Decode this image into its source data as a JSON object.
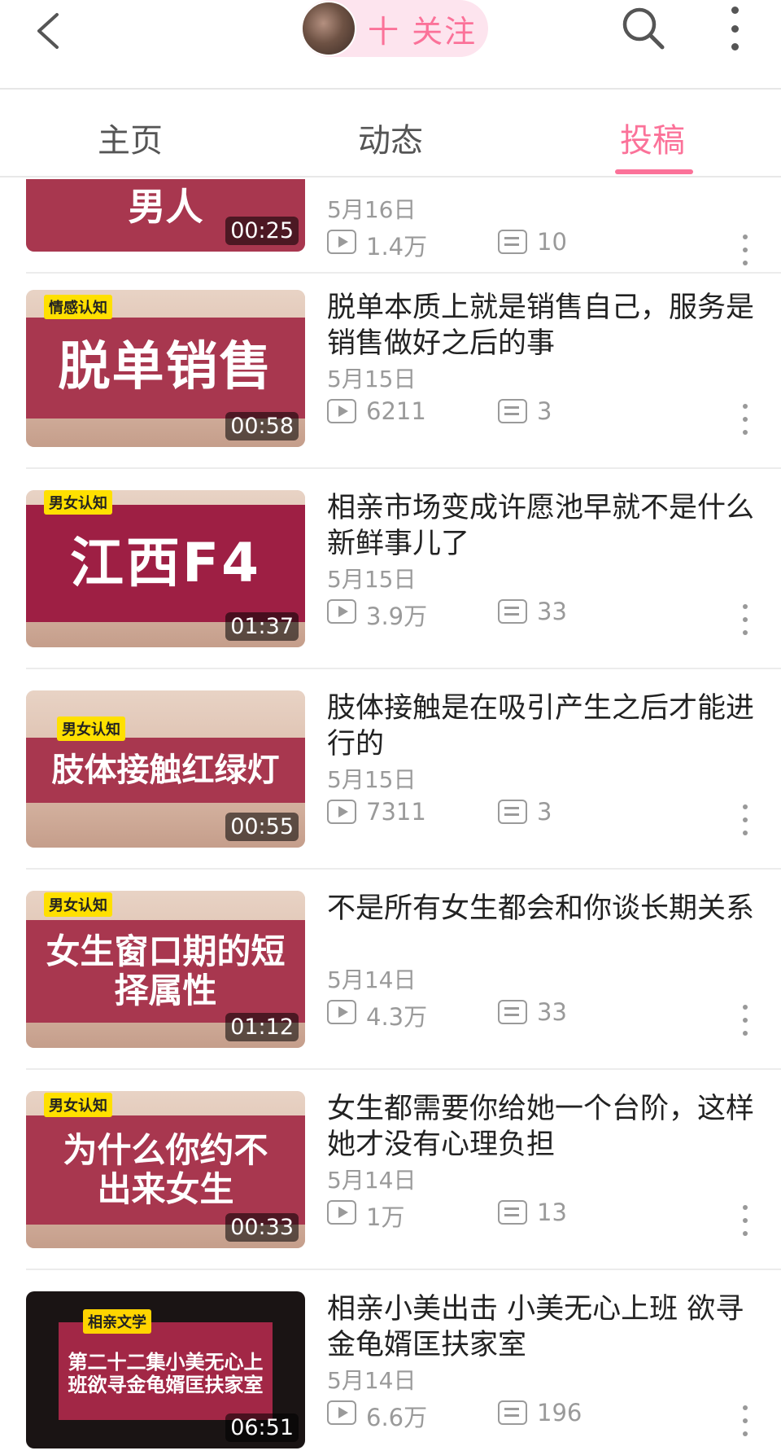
{
  "header": {
    "follow_label": "十 关注"
  },
  "tabs": [
    {
      "label": "主页",
      "active": false
    },
    {
      "label": "动态",
      "active": false
    },
    {
      "label": "投稿",
      "active": true
    }
  ],
  "accent_color": "#fb7299",
  "videos": [
    {
      "thumb_title": "男人",
      "tag": "",
      "duration": "00:25",
      "title": "",
      "date": "5月16日",
      "plays": "1.4万",
      "danmaku": "10"
    },
    {
      "thumb_title": "脱单销售",
      "tag": "情感认知",
      "duration": "00:58",
      "title": "脱单本质上就是销售自己，服务是销售做好之后的事",
      "date": "5月15日",
      "plays": "6211",
      "danmaku": "3"
    },
    {
      "thumb_title": "江西F4",
      "tag": "男女认知",
      "duration": "01:37",
      "title": "相亲市场变成许愿池早就不是什么新鲜事儿了",
      "date": "5月15日",
      "plays": "3.9万",
      "danmaku": "33"
    },
    {
      "thumb_title": "肢体接触红绿灯",
      "tag": "男女认知",
      "duration": "00:55",
      "title": "肢体接触是在吸引产生之后才能进行的",
      "date": "5月15日",
      "plays": "7311",
      "danmaku": "3"
    },
    {
      "thumb_title": "女生窗口期的短择属性",
      "tag": "男女认知",
      "duration": "01:12",
      "title": "不是所有女生都会和你谈长期关系",
      "date": "5月14日",
      "plays": "4.3万",
      "danmaku": "33"
    },
    {
      "thumb_title": "为什么你约不出来女生",
      "tag": "男女认知",
      "duration": "00:33",
      "title": "女生都需要你给她一个台阶，这样她才没有心理负担",
      "date": "5月14日",
      "plays": "1万",
      "danmaku": "13"
    },
    {
      "thumb_title": "第二十二集小美无心上班欲寻金龟婿匡扶家室",
      "tag": "相亲文学",
      "duration": "06:51",
      "title": "相亲小美出击 小美无心上班 欲寻金龟婿匡扶家室",
      "date": "5月14日",
      "plays": "6.6万",
      "danmaku": "196"
    }
  ]
}
